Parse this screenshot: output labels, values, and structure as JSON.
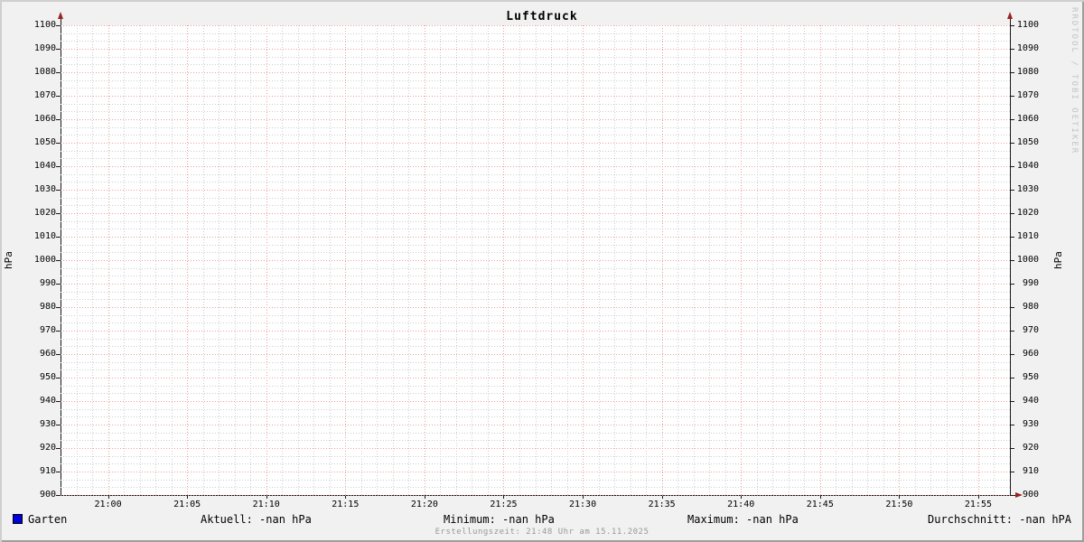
{
  "chart_data": {
    "type": "line",
    "title": "Luftdruck",
    "ylabel": "hPa",
    "xlabel": "",
    "ylim": [
      900,
      1100
    ],
    "y_tick_step": 10,
    "x_tick_labels": [
      "21:00",
      "21:05",
      "21:10",
      "21:15",
      "21:20",
      "21:25",
      "21:30",
      "21:35",
      "21:40",
      "21:45",
      "21:50",
      "21:55"
    ],
    "x_axis_minutes": 60,
    "x_first_tick_offset_min": 3,
    "x_tick_step_min": 5,
    "grid": {
      "major": true,
      "minor": true,
      "minor_per_major_y": 3,
      "minor_per_major_x": 5
    },
    "legend_position": "bottom",
    "series": [
      {
        "name": "Garten",
        "color": "#0000dd",
        "values": []
      }
    ]
  },
  "legend": {
    "series_label": "Garten",
    "stats": [
      {
        "label": "Aktuell",
        "value": "-nan hPa",
        "display": "Aktuell: -nan hPa"
      },
      {
        "label": "Minimum",
        "value": "-nan hPa",
        "display": "Minimum: -nan hPa"
      },
      {
        "label": "Maximum",
        "value": "-nan hPa",
        "display": "Maximum: -nan hPa"
      },
      {
        "label": "Durchschnitt",
        "value": "-nan hPA",
        "display": "Durchschnitt: -nan hPA"
      }
    ]
  },
  "footer": {
    "text": "Erstellungszeit: 21:48 Uhr am 15.11.2025"
  },
  "watermark": {
    "text": "RRDTOOL / TOBI OETIKER"
  },
  "colors": {
    "background": "#f1f1f1",
    "canvas": "#ffffff",
    "shade_top_left": "#cfcfcf",
    "shade_bottom_right": "#9e9e9e",
    "axis": "#1a1a1a",
    "arrow": "#992222",
    "grid_major": "#f09c9c",
    "grid_minor": "#cccccc",
    "watermark_text": "#c4c4c4",
    "footer_text": "#999999",
    "legend_swatch": "#0000dd"
  }
}
